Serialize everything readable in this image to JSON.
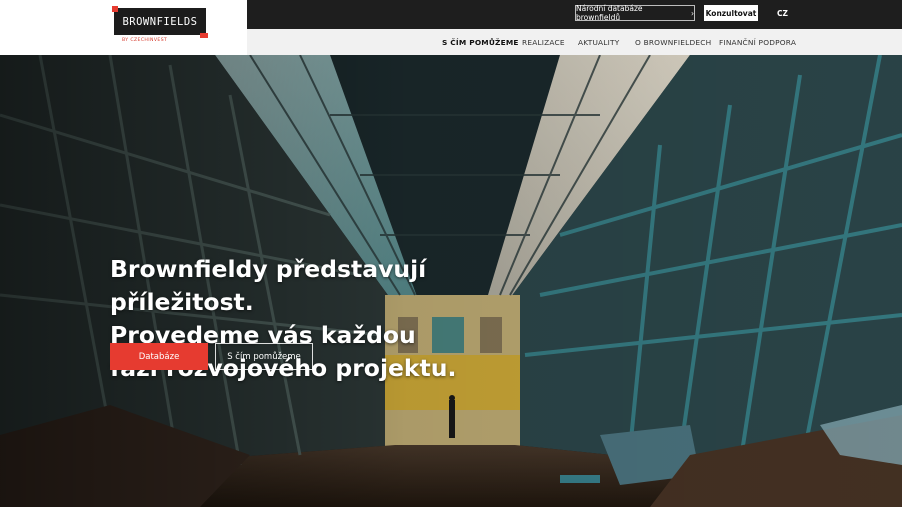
{
  "logo": {
    "text": "BROWNFIELDS",
    "subtitle": "BY CZECHINVEST"
  },
  "topbar": {
    "database_link": "Národní databáze brownfieldů",
    "consult_button": "Konzultovat",
    "language": "CZ"
  },
  "nav": {
    "items": [
      {
        "label": "S ČÍM POMŮŽEME",
        "active": true
      },
      {
        "label": "REALIZACE"
      },
      {
        "label": "AKTUALITY"
      },
      {
        "label": "O BROWNFIELDECH"
      },
      {
        "label": "FINANČNÍ PODPORA"
      }
    ]
  },
  "hero": {
    "title_lines": [
      "Brownfieldy představují",
      "příležitost.",
      "Provedeme vás každou",
      "fází rozvojového projektu."
    ],
    "primary_cta": "Databáze",
    "secondary_cta": "S čím pomůžeme"
  },
  "colors": {
    "accent": "#e63b30",
    "header_dark": "#1e1e1e",
    "nav_bg": "#f1f1f1"
  }
}
